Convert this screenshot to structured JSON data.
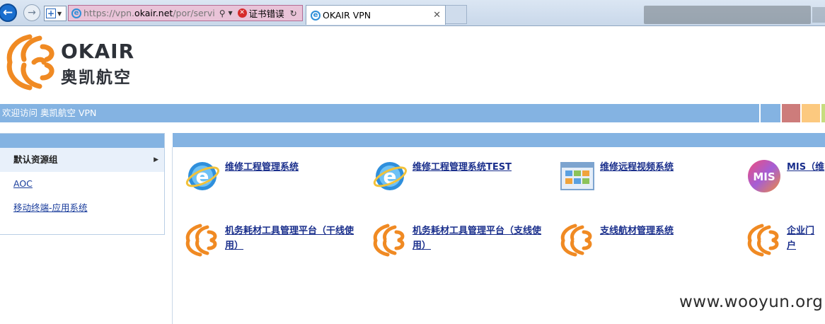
{
  "browser": {
    "address": {
      "url_prefix": "https://vpn.",
      "url_domain": "okair.net",
      "url_suffix": "/por/servi",
      "cert_error": "证书错误"
    },
    "tab_title": "OKAIR VPN",
    "icons": {
      "back": "back-arrow-icon",
      "forward": "forward-arrow-icon",
      "search": "search-icon",
      "refresh": "refresh-icon",
      "close": "close-icon"
    }
  },
  "header": {
    "brand_en": "OKAIR",
    "brand_cn": "奥凯航空",
    "welcome": "欢迎访问 奥凯航空 VPN",
    "colors": {
      "accent": "#84b3e2",
      "logo_orange": "#f08a23",
      "blocks": [
        "#84b3e2",
        "#cd7c7b",
        "#fcc97f",
        "#c6dd7f"
      ]
    }
  },
  "sidebar": {
    "items": [
      {
        "label": "默认资源组",
        "active": true
      },
      {
        "label": "AOC",
        "active": false
      },
      {
        "label": "移动终端-应用系统",
        "active": false
      }
    ]
  },
  "apps": [
    {
      "label": "维修工程管理系统",
      "icon": "ie-icon"
    },
    {
      "label": "维修工程管理系统TEST",
      "icon": "ie-icon"
    },
    {
      "label": "维修远程视频系统",
      "icon": "app-window-icon"
    },
    {
      "label": "MIS（维",
      "icon": "mis-icon"
    },
    {
      "label": "机务耗材工具管理平台（干线使用）",
      "icon": "okair-logo-icon"
    },
    {
      "label": "机务耗材工具管理平台（支线使用）",
      "icon": "okair-logo-icon"
    },
    {
      "label": "支线航材管理系统",
      "icon": "okair-logo-icon"
    },
    {
      "label": "企业门户",
      "icon": "okair-logo-icon"
    }
  ],
  "watermark": "www.wooyun.org"
}
